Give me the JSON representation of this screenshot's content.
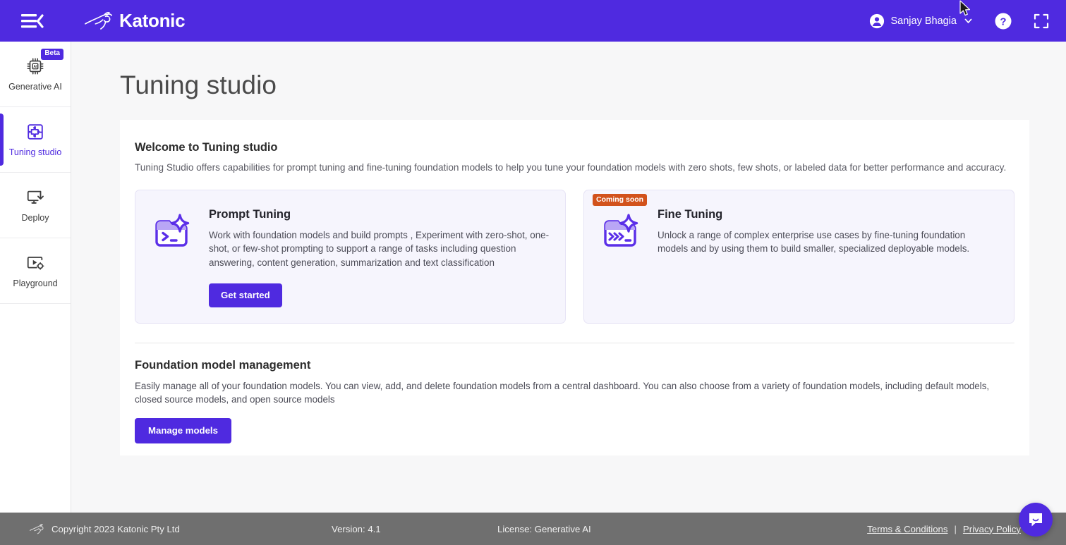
{
  "header": {
    "menu_icon": "hamburger-collapse-icon",
    "brand_name": "Katonic",
    "brand_logo_icon": "kangaroo-logo-icon",
    "user_name": "Sanjay Bhagia",
    "user_avatar_icon": "avatar-icon",
    "chevron_icon": "chevron-down-icon",
    "help_icon": "help-circle-icon",
    "fullscreen_icon": "fullscreen-icon",
    "background_color": "#4f2ae0"
  },
  "sidebar": {
    "items": [
      {
        "label": "Generative AI",
        "icon": "cpu-ai-chip-icon",
        "badge": "Beta",
        "active": false
      },
      {
        "label": "Tuning studio",
        "icon": "puzzle-icon",
        "badge": "",
        "active": true
      },
      {
        "label": "Deploy",
        "icon": "monitor-download-icon",
        "badge": "",
        "active": false
      },
      {
        "label": "Playground",
        "icon": "video-settings-icon",
        "badge": "",
        "active": false
      }
    ],
    "active_color": "#4f2ae0"
  },
  "main": {
    "page_title": "Tuning studio",
    "welcome": {
      "title": "Welcome to Tuning studio",
      "subtitle": "Tuning Studio offers capabilities for prompt tuning and fine-tuning foundation models to help you tune your foundation models with zero shots, few shots, or labeled data for better performance and accuracy."
    },
    "cards": [
      {
        "title": "Prompt Tuning",
        "icon": "terminal-sparkle-icon",
        "text": "Work with foundation models and build prompts , Experiment with zero-shot, one-shot, or few-shot prompting to support a range of tasks including question answering, content generation, summarization and text classification",
        "button_label": "Get started",
        "badge": ""
      },
      {
        "title": "Fine Tuning",
        "icon": "terminal-chevrons-sparkle-icon",
        "text": "Unlock a range of complex enterprise use cases by fine-tuning foundation models and by using them to build smaller, specialized deployable models.",
        "button_label": "",
        "badge": "Coming soon"
      }
    ],
    "foundation": {
      "title": "Foundation model management",
      "text": "Easily manage all of your foundation models. You can view, add, and delete foundation models from a central dashboard. You can also choose from a variety of foundation models, including default models, closed source models, and open source models",
      "button_label": "Manage models"
    }
  },
  "footer": {
    "logo_icon": "kangaroo-logo-icon",
    "copyright": "Copyright 2023 Katonic Pty Ltd",
    "version": "Version: 4.1",
    "license": "License: Generative AI",
    "terms_label": "Terms & Conditions",
    "separator": "|",
    "privacy_label": "Privacy Policy",
    "background_color": "#6f6f6f"
  },
  "chat": {
    "icon": "chat-bubble-icon",
    "color": "#4f2ae0"
  }
}
